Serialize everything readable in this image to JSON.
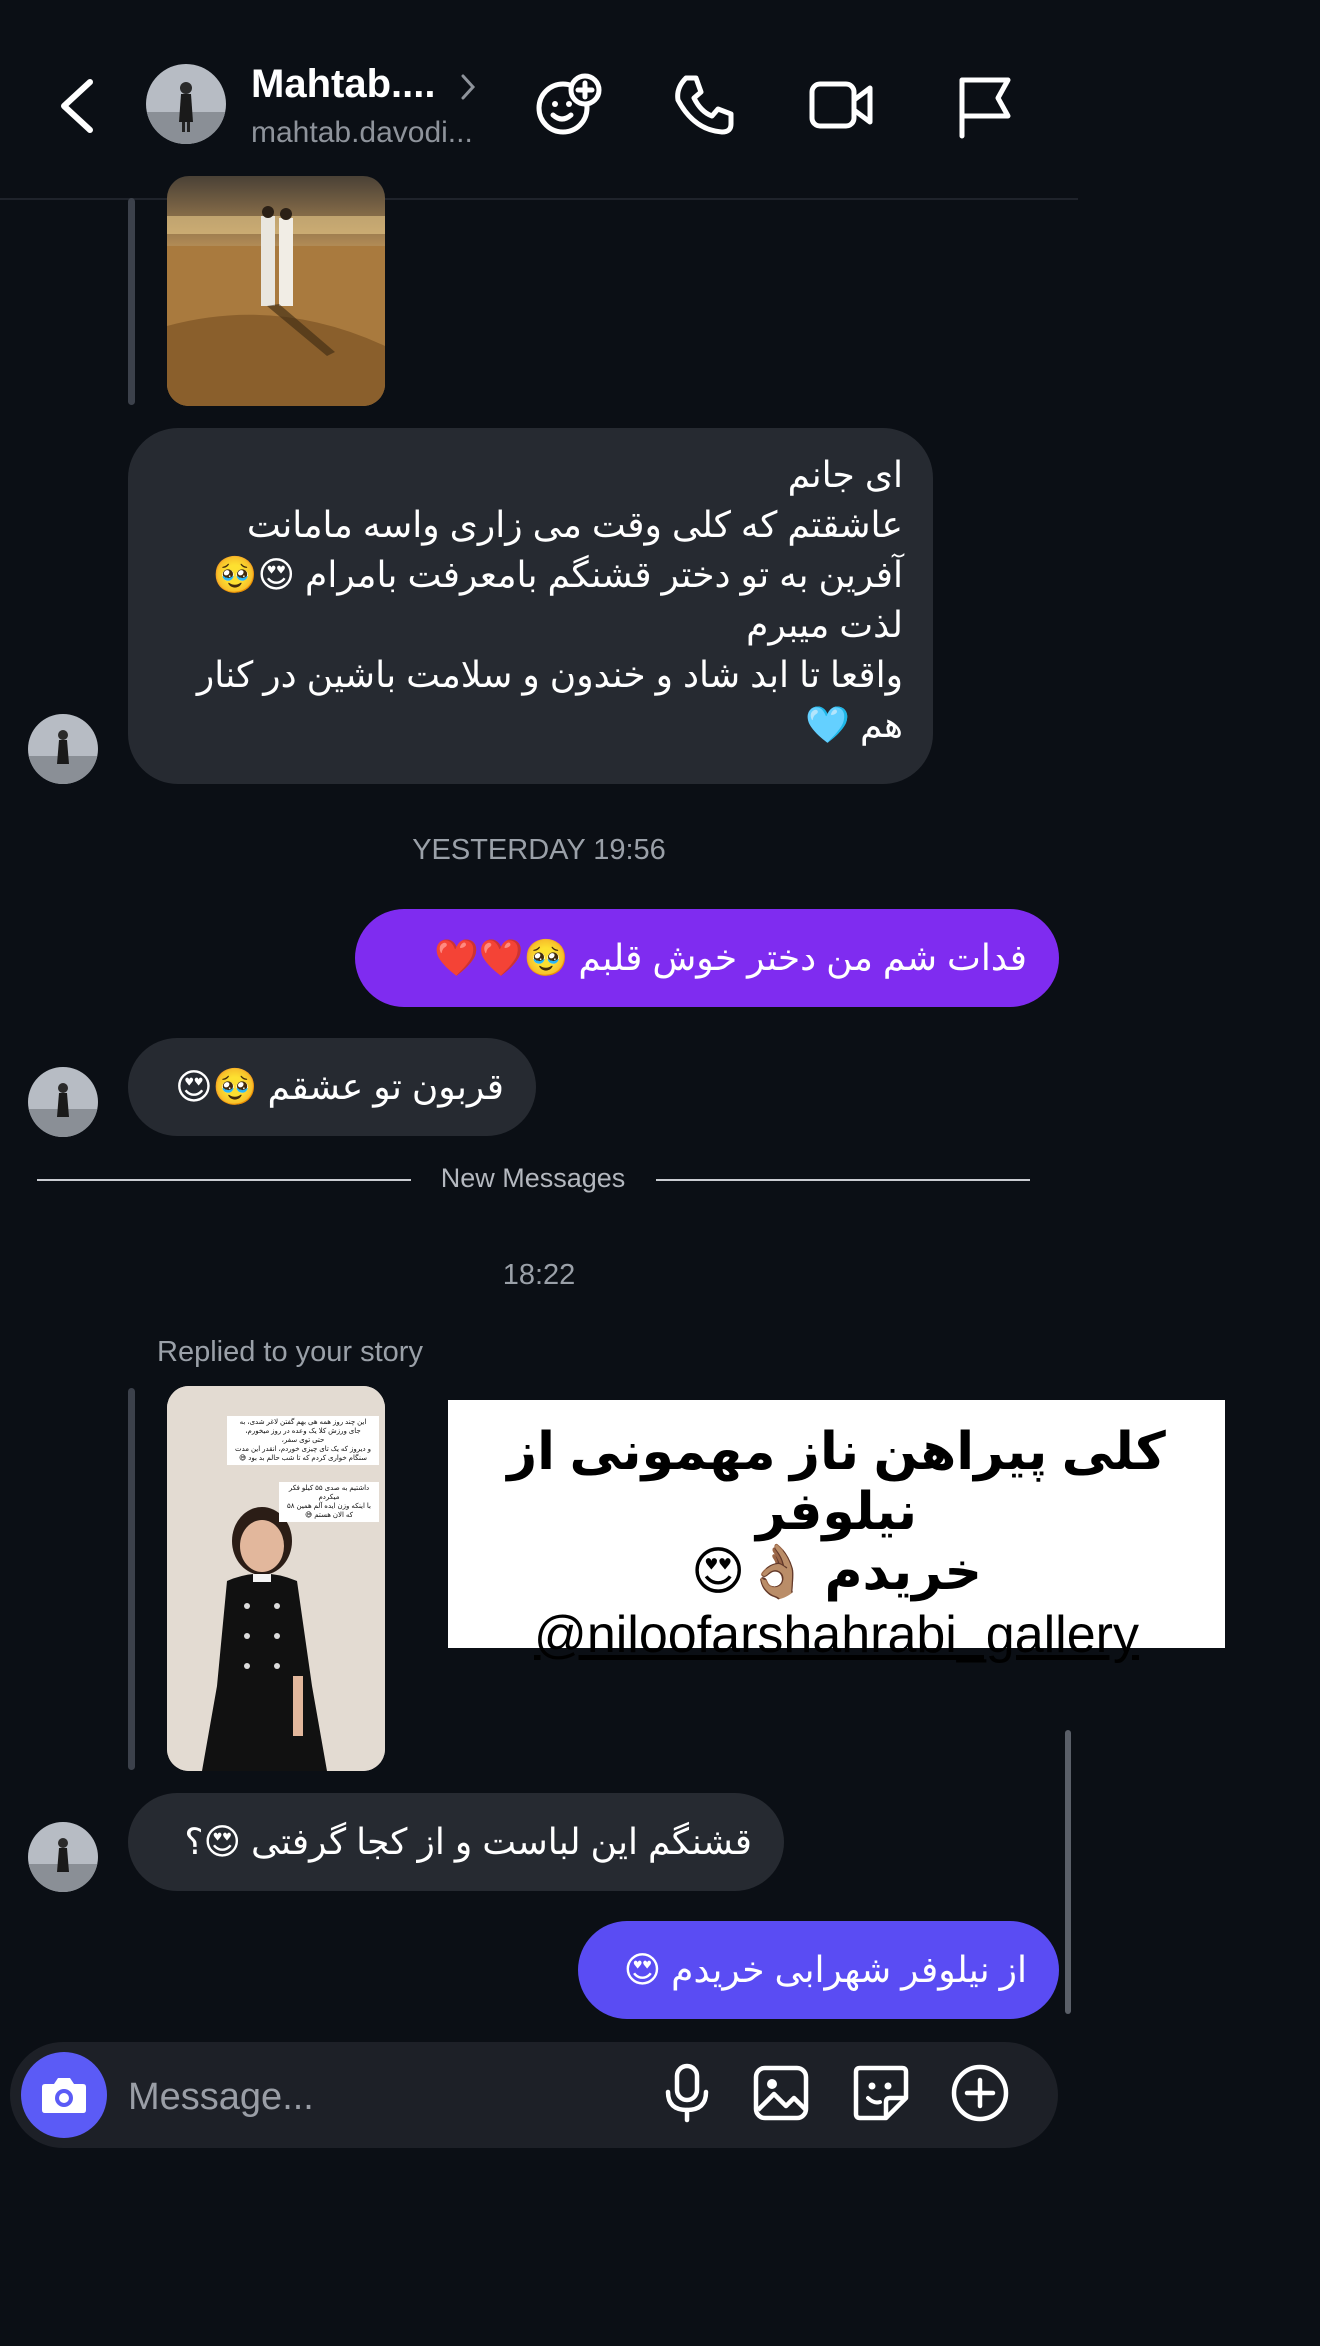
{
  "header": {
    "name": "Mahtab....",
    "username": "mahtab.davodi..."
  },
  "messages": {
    "incoming_long": [
      "ای جانم",
      "عاشقتم که کلی وقت می زاری واسه مامانت",
      "آفرین به تو دختر قشنگم بامعرفت بامرام 😍🥹",
      "لذت میبرم",
      "واقعا تا ابد شاد و خندون و سلامت باشین در کنار هم 🩵"
    ],
    "timestamp_yesterday": "YESTERDAY 19:56",
    "outgoing_1": "فدات شم من دختر خوش قلبم 🥹❤️❤️",
    "incoming_2": "قربون تو عشقم 🥹😍",
    "new_messages_label": "New Messages",
    "timestamp_today": "18:22",
    "replied_story_label": "Replied to your story",
    "story_caption_lines": [
      "این چند روز همه هی بهم گفتن لاغر شدی، به",
      "جای ورزش کلا یک وعده در روز میخورم،",
      "حتی توی سفر،",
      "و دیروز که یک تای چیزی خوردم، انقدر این مدت",
      "سنگام خواری کردم که تا شب حالم بد بود 😅",
      "داشتیم به صدی ۵۵ کیلو فکر",
      "میکردم",
      "با اینکه وزن ایده آلم همین ۵۸",
      "که الان هستم 😅"
    ],
    "sticker_line1": "کلی پیراهن ناز مهمونی از نیلوفر",
    "sticker_line2": "خریدم 👌🏽😍",
    "sticker_handle": "@niloofarshahrabi_gallery",
    "incoming_3": "قشنگم این لباست و از کجا گرفتی 😍؟",
    "outgoing_2": "از نیلوفر  شهرابی خریدم 😍"
  },
  "composer": {
    "placeholder": "Message..."
  },
  "colors": {
    "background": "#0b0f15",
    "incoming_bubble": "#262a31",
    "outgoing_purple": "#7f2cf0",
    "outgoing_indigo": "#5a4cf3",
    "camera_button": "#5b5bf6"
  },
  "icons": [
    "back-icon",
    "chevron-right-icon",
    "effects-icon",
    "phone-icon",
    "video-icon",
    "flag-icon",
    "camera-icon",
    "microphone-icon",
    "gallery-icon",
    "sticker-icon",
    "add-icon",
    "heart-reaction"
  ]
}
